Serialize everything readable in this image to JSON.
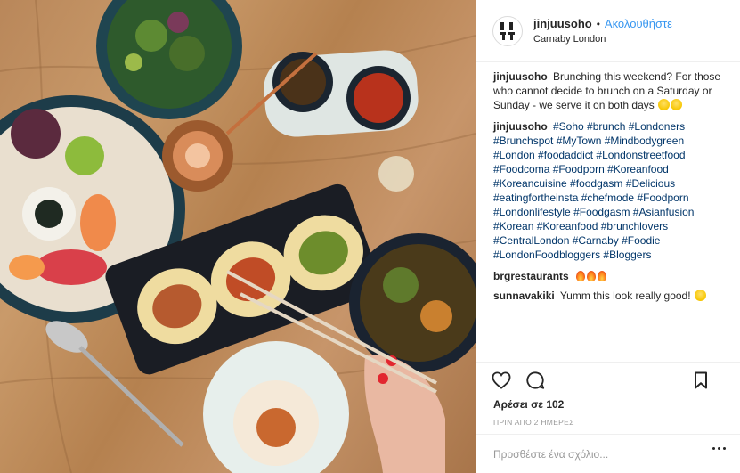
{
  "post": {
    "username": "jinjuusoho",
    "separator": "•",
    "follow_label": "Ακολουθήστε",
    "location": "Carnaby London"
  },
  "comments": [
    {
      "user": "jinjuusoho",
      "text": "Brunching this weekend? For those who cannot decide to brunch on a Saturday or Sunday - we serve it on both days",
      "emoji": [
        "smile",
        "smile"
      ]
    },
    {
      "user": "jinjuusoho",
      "tags": "#Soho #brunch #Londoners #Brunchspot #MyTown #Mindbodygreen #London #foodaddict #Londonstreetfood #Foodcoma #Foodporn #Koreanfood #Koreancuisine #foodgasm #Delicious #eatingfortheinsta #chefmode #Foodporn #Londonlifestyle #Foodgasm #Asianfusion #Korean #Koreanfood #brunchlovers #CentralLondon #Carnaby #Foodie #LondonFoodbloggers #Bloggers"
    },
    {
      "user": "brgrestaurants",
      "text": "",
      "emoji": [
        "fire",
        "fire",
        "fire"
      ]
    },
    {
      "user": "sunnavakiki",
      "text": "Yumm this look really good!",
      "emoji": [
        "smile"
      ]
    }
  ],
  "actions": {
    "icons": [
      "heart-icon",
      "comment-icon",
      "bookmark-icon"
    ]
  },
  "likes_text": "Αρέσει σε 102",
  "timestamp": "ΠΡΙΝ ΑΠΟ 2 ΗΜΕΡΕΣ",
  "comment_input": {
    "placeholder": "Προσθέστε ένα σχόλιο..."
  },
  "colors": {
    "link": "#3897f0",
    "hashtag": "#003569",
    "border": "#efefef",
    "muted": "#999999"
  }
}
